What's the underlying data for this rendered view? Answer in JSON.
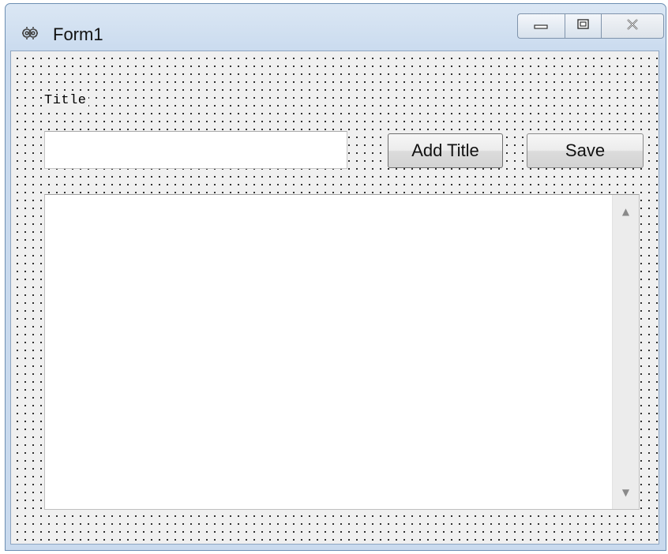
{
  "window": {
    "title": "Form1",
    "app_icon": "gear-icon",
    "caption_buttons": {
      "minimize_icon": "minimize-icon",
      "maximize_icon": "maximize-icon",
      "close_icon": "close-icon"
    }
  },
  "form": {
    "title_label": "Title",
    "title_input_value": "",
    "add_title_button": "Add Title",
    "save_button": "Save",
    "content_text": "",
    "scroll_up_glyph": "▲",
    "scroll_down_glyph": "▼"
  },
  "colors": {
    "titlebar": "#c9daee",
    "client_background": "#f0f0f0",
    "grid_dots": "#000000"
  }
}
